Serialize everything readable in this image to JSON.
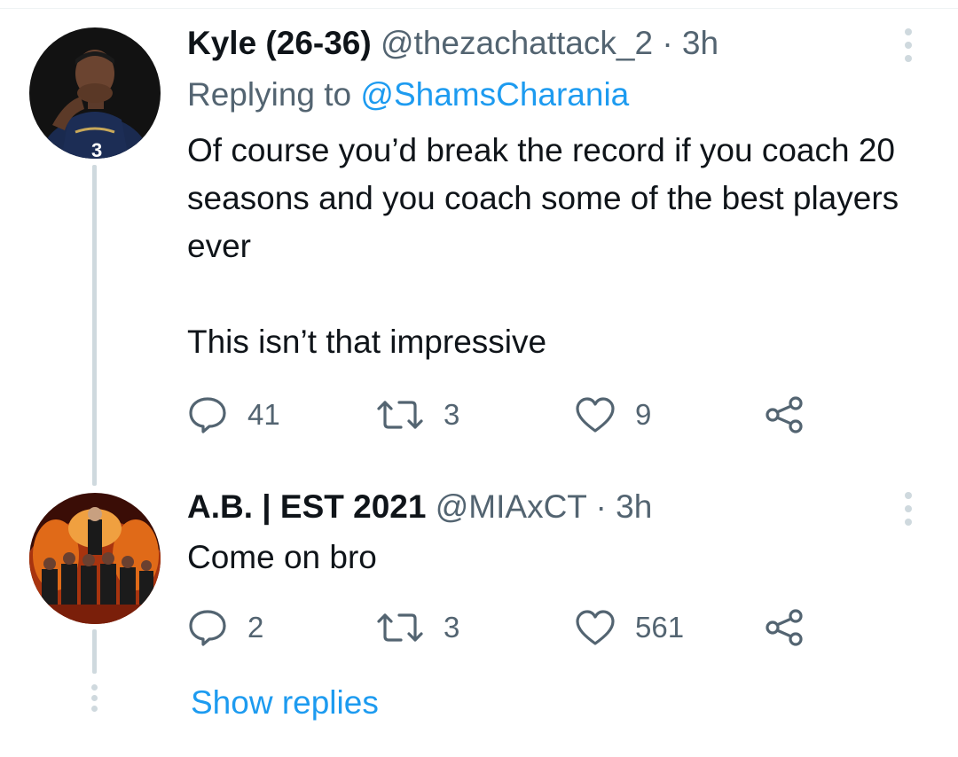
{
  "tweets": [
    {
      "name": "Kyle (26-36)",
      "handle": "@thezachattack_2",
      "separator": "·",
      "time": "3h",
      "replying_prefix": "Replying to",
      "replying_to": "@ShamsCharania",
      "text_lines": [
        "Of course you’d break the record if you coach 20 seasons and you coach some of the best players ever",
        "This isn’t that impressive"
      ],
      "replies": "41",
      "retweets": "3",
      "likes": "9",
      "avatar_icon": "player-avatar"
    },
    {
      "name": "A.B. | EST 2021",
      "handle": "@MIAxCT",
      "separator": "·",
      "time": "3h",
      "text_lines": [
        "Come on bro"
      ],
      "replies": "2",
      "retweets": "3",
      "likes": "561",
      "avatar_icon": "team-photo-avatar"
    }
  ],
  "show_replies_label": "Show replies",
  "colors": {
    "link": "#1d9bf0",
    "secondary_text": "#536471",
    "primary_text": "#0f1419",
    "thread_line": "#cfd9de"
  },
  "icons": {
    "reply": "reply-icon",
    "retweet": "retweet-icon",
    "like": "heart-icon",
    "share": "share-icon",
    "more": "more-options-icon"
  }
}
